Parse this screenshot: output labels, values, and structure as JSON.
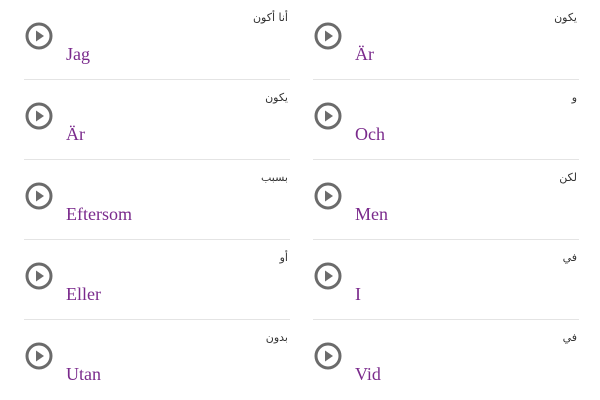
{
  "accent_color": "#7a2a8c",
  "icon_color": "#6b6b6b",
  "columns": [
    {
      "items": [
        {
          "word": "Jag",
          "translation": "أنا أكون",
          "icon": "play-circle-icon"
        },
        {
          "word": "Är",
          "translation": "يكون",
          "icon": "play-circle-icon"
        },
        {
          "word": "Eftersom",
          "translation": "بسبب",
          "icon": "play-circle-icon"
        },
        {
          "word": "Eller",
          "translation": "أو",
          "icon": "play-circle-icon"
        },
        {
          "word": "Utan",
          "translation": "بدون",
          "icon": "play-circle-icon"
        }
      ]
    },
    {
      "items": [
        {
          "word": "Är",
          "translation": "يكون",
          "icon": "play-circle-icon"
        },
        {
          "word": "Och",
          "translation": "و",
          "icon": "play-circle-icon"
        },
        {
          "word": "Men",
          "translation": "لكن",
          "icon": "play-circle-icon"
        },
        {
          "word": "I",
          "translation": "في",
          "icon": "play-circle-icon"
        },
        {
          "word": "Vid",
          "translation": "في",
          "icon": "play-circle-icon"
        }
      ]
    }
  ]
}
